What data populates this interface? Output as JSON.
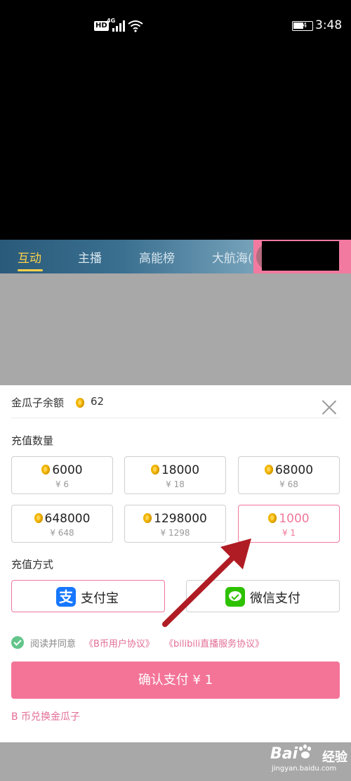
{
  "status_bar": {
    "hd": "HD",
    "network": "4G",
    "battery": "54",
    "time": "3:48"
  },
  "tabs": [
    {
      "label": "互动",
      "active": true
    },
    {
      "label": "主播",
      "active": false
    },
    {
      "label": "高能榜",
      "active": false
    },
    {
      "label": "大航海(",
      "active": false
    }
  ],
  "sheet": {
    "balance_label": "金瓜子余额",
    "balance_value": "62",
    "quantity_label": "充值数量",
    "options": [
      {
        "amount": "6000",
        "price": "¥ 6",
        "selected": false
      },
      {
        "amount": "18000",
        "price": "¥ 18",
        "selected": false
      },
      {
        "amount": "68000",
        "price": "¥ 68",
        "selected": false
      },
      {
        "amount": "648000",
        "price": "¥ 648",
        "selected": false
      },
      {
        "amount": "1298000",
        "price": "¥ 1298",
        "selected": false
      },
      {
        "amount": "1000",
        "price": "¥ 1",
        "selected": true
      }
    ],
    "method_label": "充值方式",
    "methods": [
      {
        "label": "支付宝",
        "icon": "alipay-icon",
        "icon_glyph": "支",
        "selected": true
      },
      {
        "label": "微信支付",
        "icon": "wechat-icon",
        "selected": false
      }
    ],
    "agreement": {
      "text": "阅读并同意",
      "link1": "《B币用户协议》",
      "link2": "《bilibili直播服务协议》"
    },
    "confirm_label": "确认支付 ¥ 1",
    "exchange_label": "B 币兑换金瓜子"
  },
  "watermark": {
    "logo": "Bai",
    "logo2": "经验",
    "url": "jingyan.baidu.com"
  },
  "colors": {
    "accent": "#f47498",
    "tab_active": "#ffd24a",
    "alipay": "#1677ff",
    "wechat": "#2dc100",
    "arrow": "#b01c24"
  }
}
